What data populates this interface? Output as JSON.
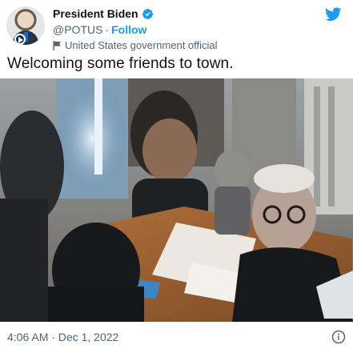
{
  "author": {
    "name": "President Biden",
    "handle": "@POTUS",
    "separator": "·",
    "follow_label": "Follow",
    "account_label": "United States government official"
  },
  "tweet": {
    "text": "Welcoming some friends to town.",
    "timestamp": "4:06 AM · Dec 1, 2022"
  },
  "icons": {
    "verified": "verified-badge-icon",
    "platform": "twitter-bird-icon",
    "account_label": "flag-icon",
    "info": "info-icon",
    "avatar_badge": "presidential-seal-icon"
  },
  "colors": {
    "accent": "#1d9bf0",
    "text_primary": "#0f1419",
    "text_secondary": "#536471"
  }
}
